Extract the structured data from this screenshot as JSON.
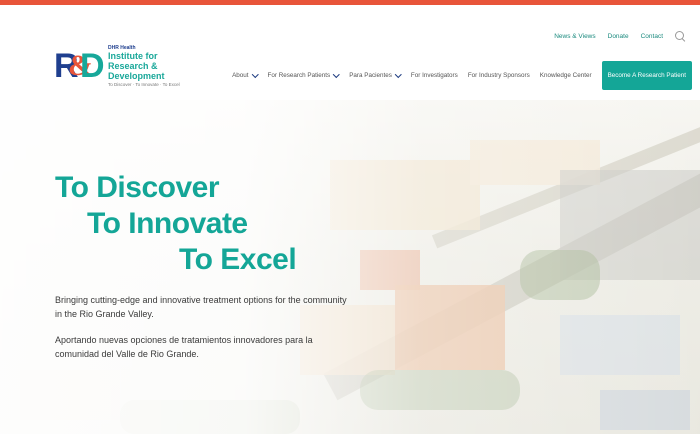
{
  "header": {
    "logo": {
      "mark_r": "R",
      "mark_amp": "&",
      "mark_d": "D",
      "sup": "DHR Health",
      "line1": "Institute for",
      "line2": "Research &",
      "line3": "Development",
      "tagline": "To Discover · To Innovate · To Excel"
    },
    "utility_nav": [
      "News & Views",
      "Donate",
      "Contact"
    ],
    "main_nav": [
      {
        "label": "About",
        "has_dropdown": true
      },
      {
        "label": "For Research Patients",
        "has_dropdown": true
      },
      {
        "label": "Para Pacientes",
        "has_dropdown": true
      },
      {
        "label": "For Investigators",
        "has_dropdown": false
      },
      {
        "label": "For Industry Sponsors",
        "has_dropdown": false
      },
      {
        "label": "Knowledge Center",
        "has_dropdown": false
      }
    ],
    "cta_label": "Become A Research Patient"
  },
  "hero": {
    "title_line1": "To Discover",
    "title_line2": "To Innovate",
    "title_line3": "To Excel",
    "text_en": "Bringing cutting-edge and innovative treatment options for the community in the Rio Grande Valley.",
    "text_es": "Aportando nuevas opciones de tratamientos innovadores para la comunidad del Valle de Rio Grande."
  },
  "colors": {
    "accent_orange": "#e8553a",
    "brand_teal": "#14a697",
    "brand_blue": "#1f3f8f"
  },
  "icons": [
    "search-icon",
    "chevron-down-icon"
  ]
}
